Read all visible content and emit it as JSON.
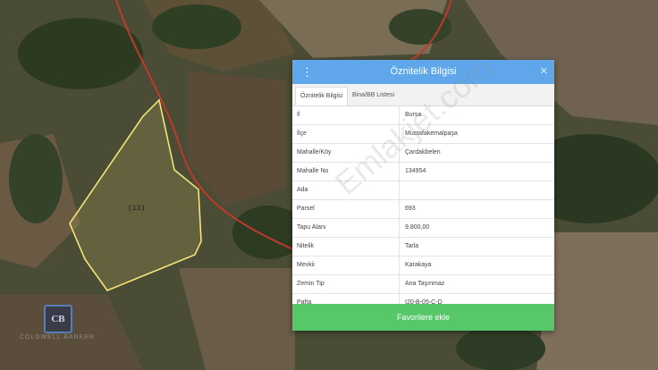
{
  "map": {
    "parcel_label": "(13)",
    "logo_text": "CB",
    "logo_caption": "COLDWELL BANKER"
  },
  "panel": {
    "title": "Öznitelik Bilgisi",
    "menu_icon": "menu-icon",
    "close_icon": "close-icon",
    "tabs": [
      {
        "label": "Öznitelik Bilgisi"
      },
      {
        "label": "Bina/BB Listesi"
      }
    ],
    "rows": [
      {
        "key": "İl",
        "value": "Bursa"
      },
      {
        "key": "İlçe",
        "value": "Mustafakemalpaşa"
      },
      {
        "key": "Mahalle/Köy",
        "value": "Çardakbelen"
      },
      {
        "key": "Mahalle No",
        "value": "134954"
      },
      {
        "key": "Ada",
        "value": ""
      },
      {
        "key": "Parsel",
        "value": "693"
      },
      {
        "key": "Tapu Alanı",
        "value": "9.800,00"
      },
      {
        "key": "Nitelik",
        "value": "Tarla"
      },
      {
        "key": "Mevkii",
        "value": "Karakaya"
      },
      {
        "key": "Zemin Tip",
        "value": "Ana Taşınmaz"
      },
      {
        "key": "Pafta",
        "value": "I20-B-05-C-D"
      }
    ],
    "favorite_button": "Favorilere ekle"
  },
  "watermark": "Emlakjet.com",
  "colors": {
    "header": "#5fa7ea",
    "button": "#56c86a",
    "parcel_outline": "#f2e27a",
    "road": "#c0392b"
  }
}
